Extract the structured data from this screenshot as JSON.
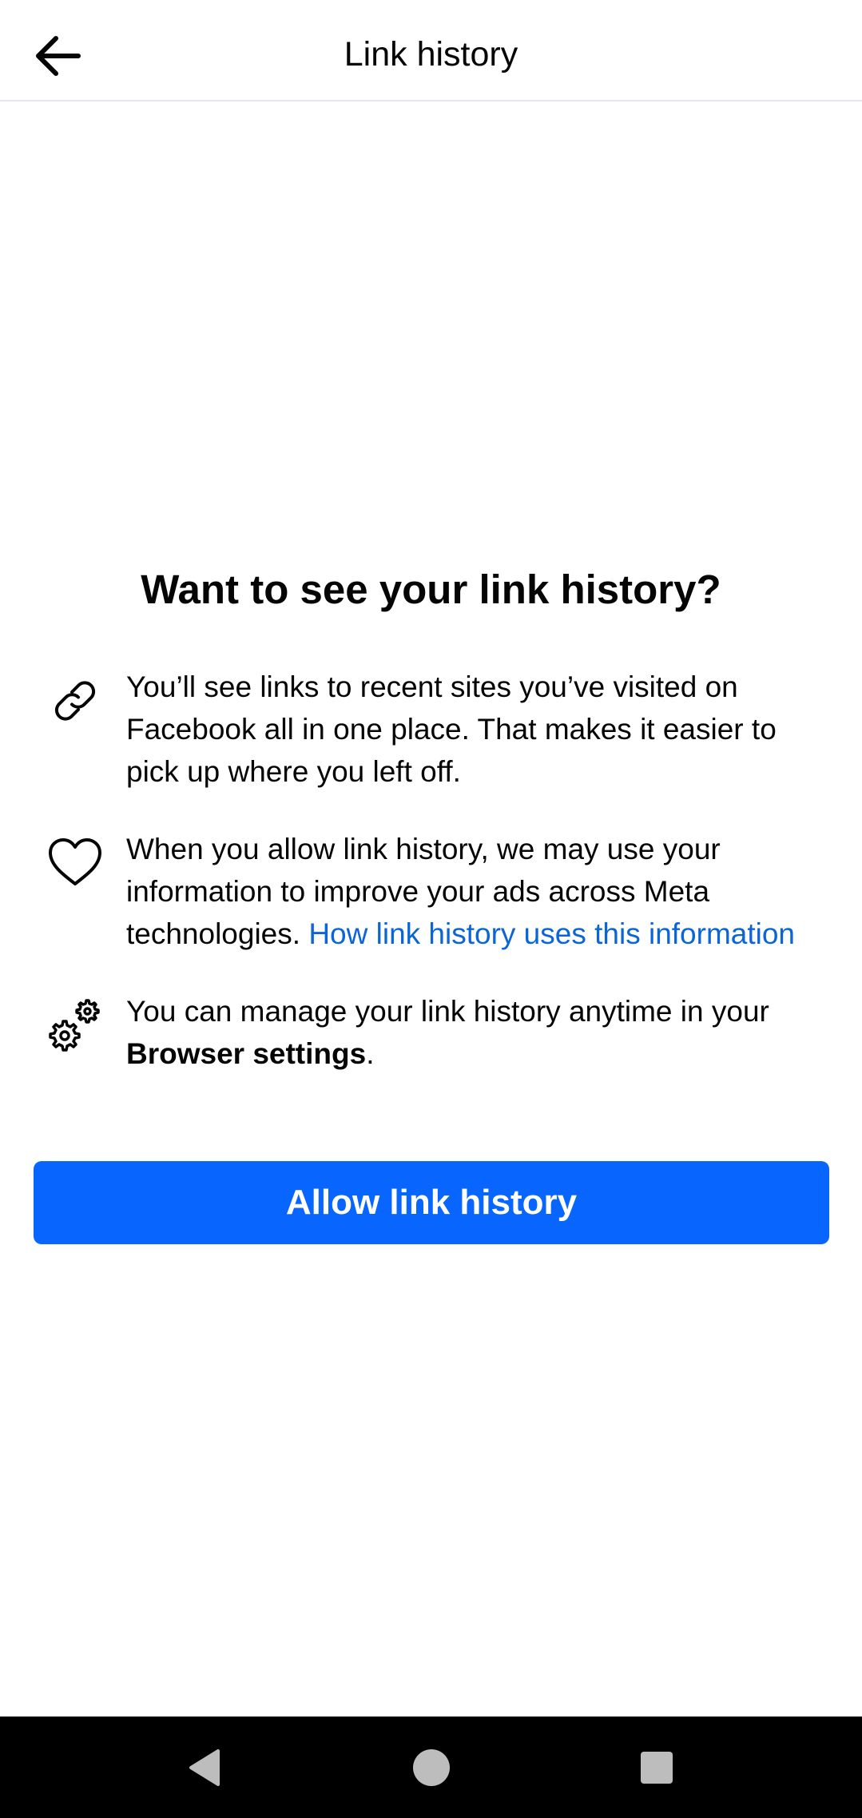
{
  "header": {
    "title": "Link history",
    "back_icon": "arrow-left-icon"
  },
  "main": {
    "title": "Want to see your link history?",
    "items": [
      {
        "icon": "link-icon",
        "text": "You’ll see links to recent sites you’ve visited on Facebook all in one place. That makes it easier to pick up where you left off."
      },
      {
        "icon": "heart-icon",
        "text": "When you allow link history, we may use your information to improve your ads across Meta technologies. ",
        "link_text": "How link history uses this information"
      },
      {
        "icon": "gears-icon",
        "text_before": "You can manage your link history anytime in your ",
        "bold_text": "Browser settings",
        "text_after": "."
      }
    ],
    "primary_button": "Allow link history"
  },
  "colors": {
    "primary": "#0866ff",
    "link": "#0a66d8",
    "text": "#050505",
    "nav_bar": "#000000"
  },
  "nav_bar": {
    "back_icon": "triangle-back-icon",
    "home_icon": "circle-home-icon",
    "recents_icon": "square-recents-icon"
  }
}
